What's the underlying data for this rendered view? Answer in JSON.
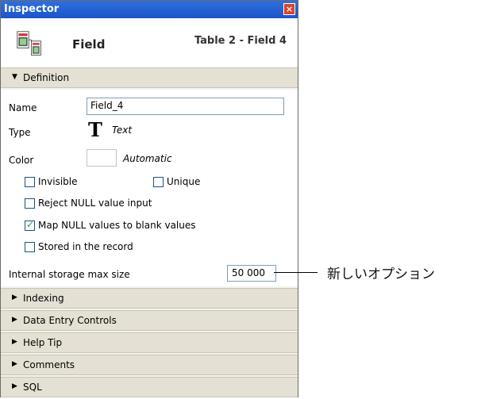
{
  "window": {
    "title": "Inspector",
    "close_symbol": "×"
  },
  "header": {
    "title": "Field",
    "subtitle": "Table 2 - Field 4",
    "icon": "field-inspector-icon"
  },
  "sections": {
    "definition": "Definition",
    "indexing": "Indexing",
    "data_entry": "Data Entry Controls",
    "help_tip": "Help Tip",
    "comments": "Comments",
    "sql": "SQL"
  },
  "fields": {
    "name_label": "Name",
    "name_value": "Field_4",
    "type_label": "Type",
    "type_glyph": "T",
    "type_value": "Text",
    "color_label": "Color",
    "color_value": "Automatic",
    "storage_label": "Internal storage max size",
    "storage_value": "50 000"
  },
  "checkboxes": {
    "invisible": {
      "label": "Invisible",
      "checked": false
    },
    "unique": {
      "label": "Unique",
      "checked": false
    },
    "reject_null": {
      "label": "Reject NULL value input",
      "checked": false
    },
    "map_null": {
      "label": "Map NULL values to blank values",
      "checked": true
    },
    "stored": {
      "label": "Stored in the record",
      "checked": false
    }
  },
  "annotation": {
    "text": "新しいオプション"
  },
  "colors": {
    "titlebar": "#1d55c8",
    "section_bg": "#e4e1d4",
    "check": "#21a121"
  }
}
